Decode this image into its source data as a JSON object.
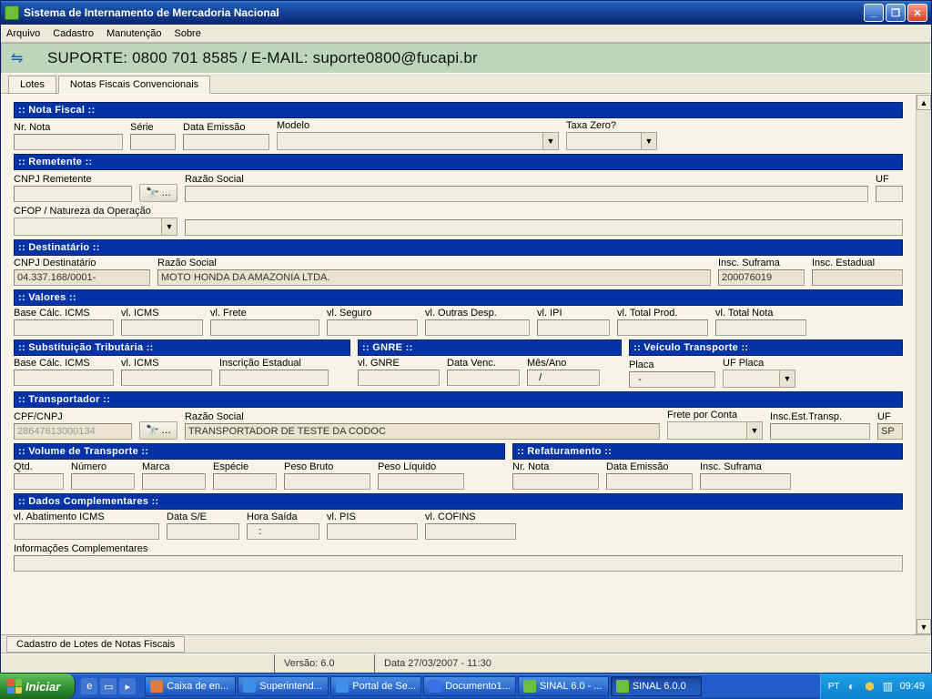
{
  "window": {
    "title": "Sistema de Internamento de Mercadoria Nacional"
  },
  "menu": {
    "arquivo": "Arquivo",
    "cadastro": "Cadastro",
    "manutencao": "Manutenção",
    "sobre": "Sobre"
  },
  "support": {
    "text": "SUPORTE: 0800 701 8585 / E-MAIL: suporte0800@fucapi.br"
  },
  "tabs": {
    "lotes": "Lotes",
    "nfconv": "Notas Fiscais Convencionais"
  },
  "sec": {
    "nota_fiscal": ":: Nota Fiscal ::",
    "remetente": ":: Remetente ::",
    "destinatario": ":: Destinatário ::",
    "valores": ":: Valores ::",
    "subst": ":: Substituição Tributária ::",
    "gnre": ":: GNRE ::",
    "veiculo": ":: Veículo Transporte ::",
    "transp": ":: Transportador ::",
    "volume": ":: Volume de Transporte ::",
    "refat": ":: Refaturamento ::",
    "dados": ":: Dados Complementares ::"
  },
  "lbls": {
    "nr_nota": "Nr. Nota",
    "serie": "Série",
    "data_emissao": "Data Emissão",
    "modelo": "Modelo",
    "taxa_zero": "Taxa Zero?",
    "cnpj_rem": "CNPJ Remetente",
    "razao_social": "Razão Social",
    "uf": "UF",
    "cfop": "CFOP / Natureza da Operação",
    "cnpj_dest": "CNPJ Destinatário",
    "insc_suframa": "Insc. Suframa",
    "insc_estadual": "Insc. Estadual",
    "base_icms": "Base Cálc. ICMS",
    "vl_icms": "vl. ICMS",
    "vl_frete": "vl. Frete",
    "vl_seguro": "vl. Seguro",
    "vl_outras": "vl. Outras Desp.",
    "vl_ipi": "vl. IPI",
    "vl_total_prod": "vl. Total Prod.",
    "vl_total_nota": "vl. Total Nota",
    "insc_est": "Inscrição Estadual",
    "vl_gnre": "vl. GNRE",
    "data_venc": "Data Venc.",
    "mes_ano": "Mês/Ano",
    "placa": "Placa",
    "uf_placa": "UF Placa",
    "cpf_cnpj": "CPF/CNPJ",
    "frete_conta": "Frete por Conta",
    "insc_est_transp": "Insc.Est.Transp.",
    "qtd": "Qtd.",
    "numero": "Número",
    "marca": "Marca",
    "especie": "Espécie",
    "peso_bruto": "Peso Bruto",
    "peso_liquido": "Peso Líquido",
    "vl_abat": "vl. Abatimento ICMS",
    "data_se": "Data S/E",
    "hora_saida": "Hora Saída",
    "vl_pis": "vl. PIS",
    "vl_cofins": "vl. COFINS",
    "info_comp": "Informações Complementares"
  },
  "vals": {
    "cnpj_dest": "04.337.168/0001-",
    "dest_razao": "MOTO HONDA DA AMAZONIA LTDA.",
    "dest_suframa": "200076019",
    "transp_cnpj": "28647613000134",
    "transp_razao": "TRANSPORTADOR DE TESTE DA CODOC",
    "transp_uf": "SP",
    "placa": "  -",
    "hora_saida": "   :",
    "btn_search": "…"
  },
  "status_tab": "Cadastro de Lotes de Notas Fiscais",
  "statusbar": {
    "versao_lbl": "Versão: 6.0",
    "data_lbl": "Data 27/03/2007 - 11:30"
  },
  "taskbar": {
    "start": "Iniciar",
    "items": [
      {
        "label": "Caixa de en...",
        "color": "#E07A3C"
      },
      {
        "label": "Superintend...",
        "color": "#3C8FE5"
      },
      {
        "label": "Portal de Se...",
        "color": "#3C8FE5"
      },
      {
        "label": "Documento1...",
        "color": "#3C6FE5"
      },
      {
        "label": "SINAL 6.0 - ...",
        "color": "#6BBF3B"
      },
      {
        "label": "SINAL 6.0.0",
        "color": "#6BBF3B",
        "active": true
      }
    ],
    "lang": "PT",
    "clock": "09:49"
  }
}
